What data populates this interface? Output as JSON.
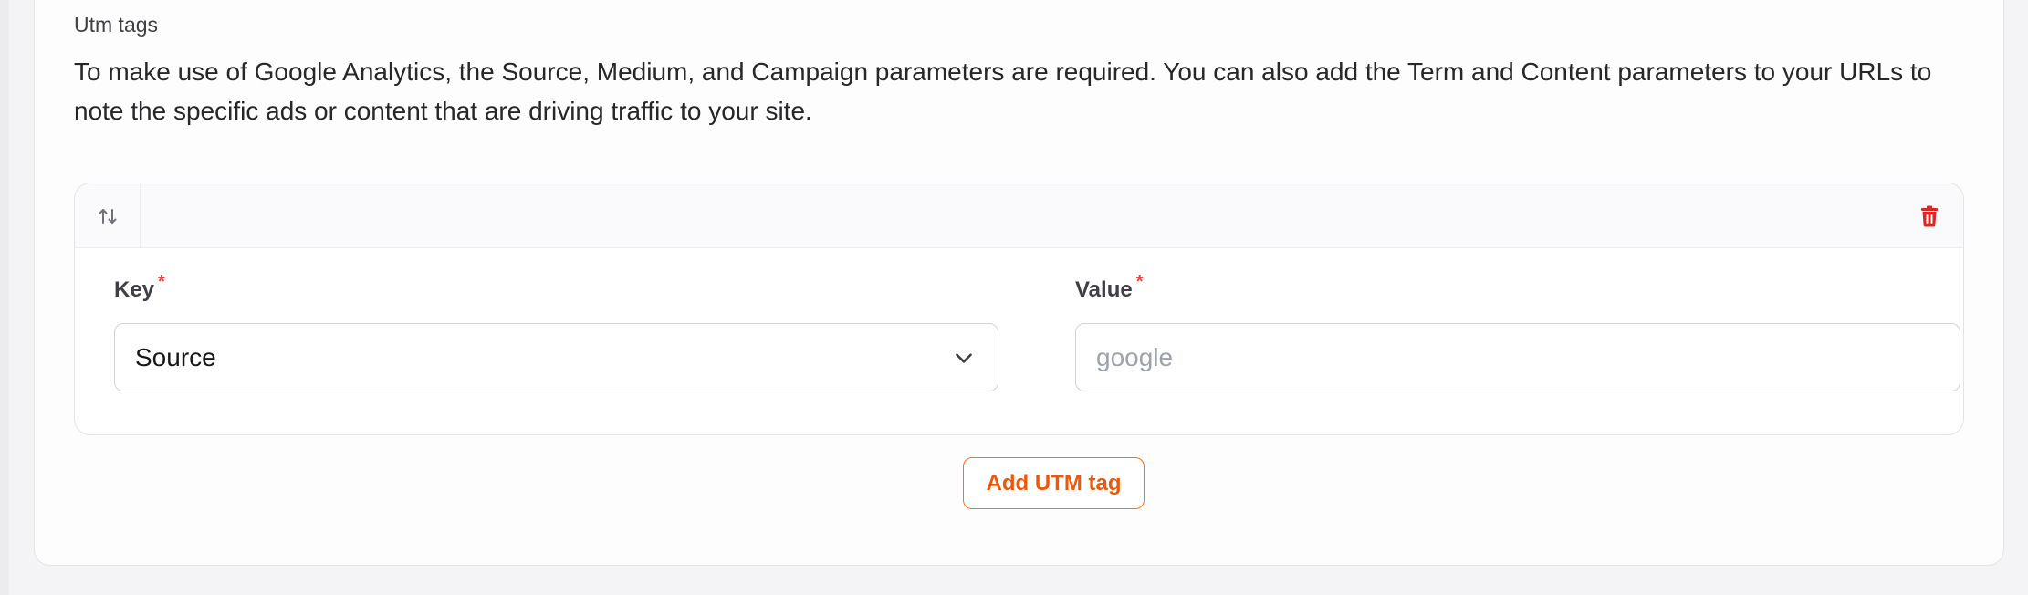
{
  "section": {
    "label": "Utm tags",
    "description": "To make use of Google Analytics, the Source, Medium, and Campaign parameters are required. You can also add the Term and Content parameters to your URLs to note the specific ads or content that are driving traffic to your site."
  },
  "utm_items": [
    {
      "key_label": "Key",
      "key_value": "Source",
      "value_label": "Value",
      "value_placeholder": "google",
      "value_value": "",
      "required_mark": "*"
    }
  ],
  "actions": {
    "add_label": "Add UTM tag"
  },
  "icons": {
    "reorder": "arrows-up-down-icon",
    "delete": "trash-icon",
    "select": "chevron-down-icon"
  },
  "colors": {
    "accent": "#ea580c",
    "danger": "#dc2626",
    "required": "#ef4444"
  }
}
